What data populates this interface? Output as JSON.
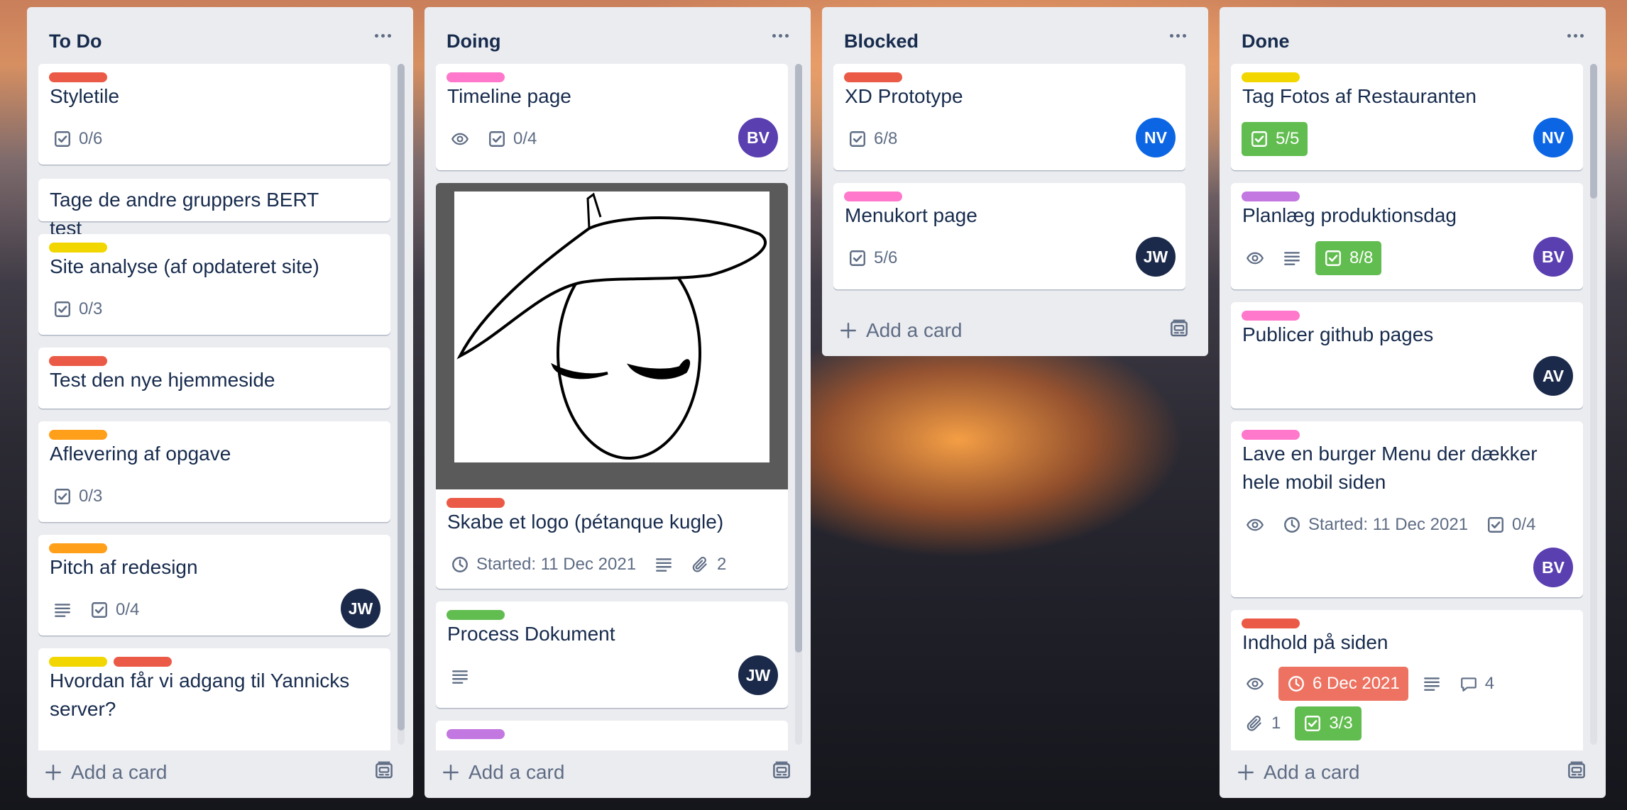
{
  "colors": {
    "red": "#eb5a46",
    "pink": "#ff78cb",
    "yellow": "#f2d600",
    "orange": "#ff9f1a",
    "green": "#61bd4f",
    "purple": "#c377e0",
    "avatar_bv": "#5a3fb0",
    "avatar_nv": "#0c66e4",
    "avatar_jw": "#1b2a4a",
    "avatar_av": "#1b2a4a"
  },
  "add_card_label": "Add a card",
  "lists": [
    {
      "title": "To Do",
      "cards": [
        {
          "labels": [
            "red"
          ],
          "title": "Styletile",
          "checklist": "0/6"
        },
        {
          "labels": [],
          "title": "Tage de andre gruppers BERT test"
        },
        {
          "labels": [
            "yellow"
          ],
          "title": "Site analyse (af opdateret site)",
          "checklist": "0/3"
        },
        {
          "labels": [
            "red"
          ],
          "title": "Test den nye hjemmeside"
        },
        {
          "labels": [
            "orange"
          ],
          "title": "Aflevering af opgave",
          "checklist": "0/3"
        },
        {
          "labels": [
            "orange"
          ],
          "title": "Pitch af redesign",
          "description": true,
          "checklist": "0/4",
          "avatar": "JW"
        },
        {
          "labels": [
            "yellow",
            "red"
          ],
          "title": "Hvordan får vi adgang til Yannicks server?"
        }
      ]
    },
    {
      "title": "Doing",
      "cards": [
        {
          "labels": [
            "pink"
          ],
          "title": "Timeline page",
          "watching": true,
          "checklist": "0/4",
          "avatar": "BV"
        },
        {
          "labels": [
            "red"
          ],
          "title": "Skabe et logo (pétanque kugle)",
          "start": "Started: 11 Dec 2021",
          "description": true,
          "attachments": "2"
        },
        {
          "labels": [
            "green"
          ],
          "title": "Process Dokument",
          "description": true,
          "avatar": "JW"
        },
        {
          "labels": [
            "purple"
          ],
          "title": ""
        }
      ]
    },
    {
      "title": "Blocked",
      "cards": [
        {
          "labels": [
            "red"
          ],
          "title": "XD Prototype",
          "checklist": "6/8",
          "avatar": "NV"
        },
        {
          "labels": [
            "pink"
          ],
          "title": "Menukort page",
          "checklist": "5/6",
          "avatar": "JW"
        }
      ]
    },
    {
      "title": "Done",
      "cards": [
        {
          "labels": [
            "yellow"
          ],
          "title": "Tag Fotos af Restauranten",
          "checklist": "5/5",
          "avatar": "NV"
        },
        {
          "labels": [
            "purple"
          ],
          "title": "Planlæg produktionsdag",
          "watching": true,
          "description": true,
          "checklist": "8/8",
          "avatar": "BV"
        },
        {
          "labels": [
            "pink"
          ],
          "title": "Publicer github pages",
          "avatar": "AV"
        },
        {
          "labels": [
            "pink"
          ],
          "title": "Lave en burger Menu der dækker hele mobil siden",
          "watching": true,
          "start": "Started: 11 Dec 2021",
          "checklist": "0/4",
          "avatar": "BV"
        },
        {
          "labels": [
            "red"
          ],
          "title": "Indhold på siden",
          "watching": true,
          "due": "6 Dec 2021",
          "description": true,
          "comments": "4",
          "attachments": "1",
          "checklist": "3/3"
        }
      ]
    }
  ]
}
